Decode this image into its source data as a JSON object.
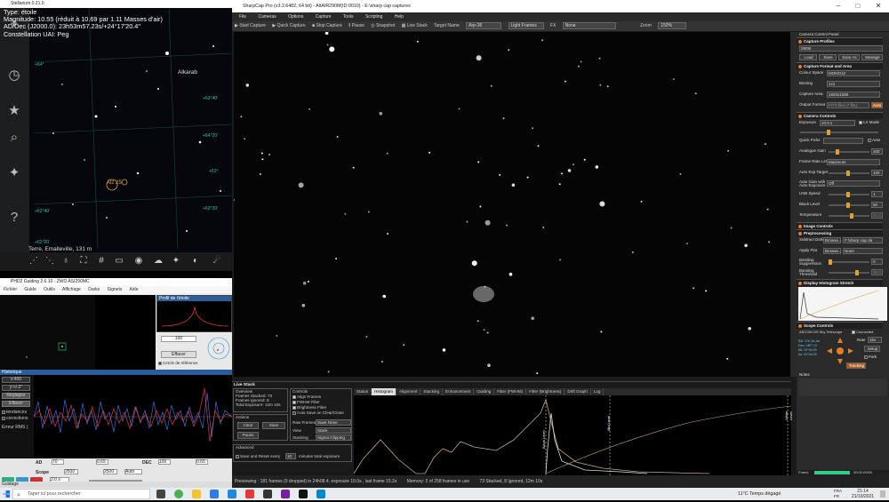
{
  "stellarium": {
    "title": "Stellarium 0.21.0",
    "info": {
      "type": "Type: étoile",
      "magnitude": "Magnitude: 10.55 (réduit à 10.69 par 1.11 Masses d'air)",
      "radec": "AD/Dec (J2000.0): 23h53m57.23s/+24°17'20.4\"",
      "constellation": "Constellation UAI: Peg"
    },
    "labels": {
      "star1": "Alkarab",
      "target": "Alz 25",
      "location": "Terre, Emalleville, 131 m",
      "grid": [
        "+64°",
        "+63°40'",
        "+64°20'",
        "+63°",
        "+62°20'",
        "+62°40'",
        "+62°20'"
      ]
    },
    "side_icons": [
      "location-icon",
      "clock-icon",
      "sky-settings-icon",
      "search-icon",
      "settings-icon",
      "help-icon"
    ],
    "bottom_icons": [
      "constellation-lines-icon",
      "constellation-names-icon",
      "constellation-art-icon",
      "equatorial-grid-icon",
      "azimuthal-grid-icon",
      "ground-icon",
      "cardinal-points-icon",
      "atmosphere-icon",
      "nebulae-icon",
      "planets-icon",
      "telescope-icon"
    ]
  },
  "phd": {
    "title": "PHD2 Guiding 2.6.10 - ZWO ASI290MC",
    "menu": [
      "Fichier",
      "Guide",
      "Outils",
      "Affichage",
      "Darks",
      "Signets",
      "Aide"
    ],
    "star_profile": "Profil de l'étoile",
    "graph_title": "Historique",
    "ctrl_value": "100",
    "ctrl_button": "Effacer",
    "ref_circle": "Cercle de référence",
    "left": {
      "scale": "x:400",
      "yscale": "y:+/-2\"",
      "settings": "Réglages",
      "clear": "Effacer",
      "trends": "tendances",
      "corrections": "corrections",
      "rms": [
        "Erreur RMS ("
      ]
    },
    "bottom": {
      "ad_label": "AD",
      "dec_label": "DEC",
      "scope_label": "Scope",
      "ad_val": "70",
      "dec_val": "100",
      "ad_min": "0.65",
      "dec_min": "0.65",
      "ad_max": "2500",
      "dec_max": "2500",
      "auto": "Auto",
      "exposure": "2.0 s"
    },
    "status": "Guidage"
  },
  "sharpcap": {
    "title": "SharpCap Pro (v3.2.6482, 64 bit) - AltAIR290M(ID:0010) - E:\\sharp cap captures",
    "menu": [
      "File",
      "Cameras",
      "Options",
      "Capture",
      "Tools",
      "Scripting",
      "Help"
    ],
    "toolbar": {
      "start": "Start Capture",
      "quick": "Quick Capture",
      "stop": "Stop Capture",
      "pause": "Pause",
      "snapshot": "Snapshot",
      "live_stack": "Live Stack",
      "target_label": "Target Name",
      "target": "Arp-28",
      "frames": "Light Frames",
      "fx_label": "FX",
      "fx": "None",
      "zoom_label": "Zoom",
      "zoom": "150%"
    },
    "live_stack": {
      "header": "Live Stack",
      "overview": "Overview",
      "frames_stacked": "Frames Stacked: 73",
      "frames_ignored": "Frames Ignored: 8",
      "total_exposure": "Total Exposure: 12m 10s",
      "actions": "Actions",
      "clear": "Clear",
      "save": "Save",
      "pause": "Pause",
      "controls": "Controls",
      "align": "Align Frames",
      "fwhm": "FWHM Filter",
      "brightness": "Brightness Filter",
      "auto_save": "Auto Save on Clear/Close",
      "raw_frames": "Raw Frames",
      "raw_frames_val": "Save None",
      "view": "View",
      "view_val": "Stack",
      "stacking": "Stacking",
      "stacking_val": "Sigma Clipping",
      "advanced": "Advanced",
      "save_reset": "Save and Reset every",
      "minutes": "minutes total exposure",
      "minutes_val": "10"
    },
    "tabs": [
      "Status",
      "Histogram",
      "Alignment",
      "Stacking",
      "Enhancement",
      "Guiding",
      "Filter (FWHM)",
      "Filter (Brightness)",
      "Drift Graph",
      "Log"
    ],
    "active_tab": 1,
    "graph_labels": {
      "black": "Black Level",
      "mid": "Mid Level",
      "white": "White Level"
    },
    "status_bar": [
      "Previewing : 181 frames (0 dropped) in 24h08.4, exposure 10.0s , last frame 15.2s",
      "Memory: 2 of 258 frames in use",
      "73 Stacked, 8 Ignored, 12m 10s"
    ]
  },
  "ccp": {
    "title": "Camera Control Panel",
    "sections": {
      "profiles": "Capture Profiles",
      "format": "Capture Format and Area",
      "camera": "Camera Controls",
      "image": "Image Controls",
      "preproc": "Preprocessing",
      "histogram": "Display Histogram Stretch",
      "scope": "Scope Controls"
    },
    "profile": "290M",
    "profile_buttons": [
      "Load",
      "Save",
      "Save As",
      "Manage"
    ],
    "format": [
      {
        "label": "Colour Space",
        "value": "MONO12"
      },
      {
        "label": "Binning",
        "value": "1x1"
      },
      {
        "label": "Capture Area",
        "value": "1920x1080"
      },
      {
        "label": "Output Format",
        "value": "FITS files (*.fits)"
      }
    ],
    "auto_label": "Auto",
    "exposure_label": "Exposure",
    "exposure": "10.0 s",
    "lx_mode": "LX Mode",
    "quick_picks": "Quick Picks",
    "camera_rows": [
      {
        "label": "Analogue Gain",
        "value": "200"
      },
      {
        "label": "Frame Rate Limit",
        "value": "Maximum"
      },
      {
        "label": "Auto Exp Target",
        "value": "100"
      },
      {
        "label": "Auto Gain with Auto Exposure",
        "value": "Off"
      },
      {
        "label": "USB Speed",
        "value": "1"
      },
      {
        "label": "Black Level",
        "value": "50"
      },
      {
        "label": "Temperature",
        "value": "22.4"
      }
    ],
    "preproc_rows": [
      {
        "label": "Subtract Dark",
        "value": "F:\\sharp cap da"
      },
      {
        "label": "Apply Flat",
        "value": "None"
      },
      {
        "label": "Banding Suppression",
        "value": "0"
      },
      {
        "label": "Banding Threshold",
        "value": "35.0"
      }
    ],
    "browse": "Browse...",
    "scope": {
      "name": "ASCOM GS Sky Telescope",
      "connected": "Connected",
      "rate_label": "Rate",
      "rate": "16x",
      "setup": "Setup",
      "park": "Park",
      "tracking": "Tracking",
      "ra": "RA: 17h 16.1m",
      "dec": "Dec: +80°.13",
      "alt": "Alt: 22°44.09",
      "az": "Az: 22°44.09"
    },
    "notes": "Notes",
    "frame_label": "Frame",
    "frame_val": "00:02:00/00"
  },
  "taskbar": {
    "search": "Taper ici pour rechercher",
    "weather": "11°C  Temps dégagé",
    "lang": "FRA",
    "lang2": "FR",
    "time": "21:14",
    "date": "21/10/2021"
  },
  "colors": {
    "accent": "#e67e22",
    "phd_blue": "#2a5d9a"
  }
}
